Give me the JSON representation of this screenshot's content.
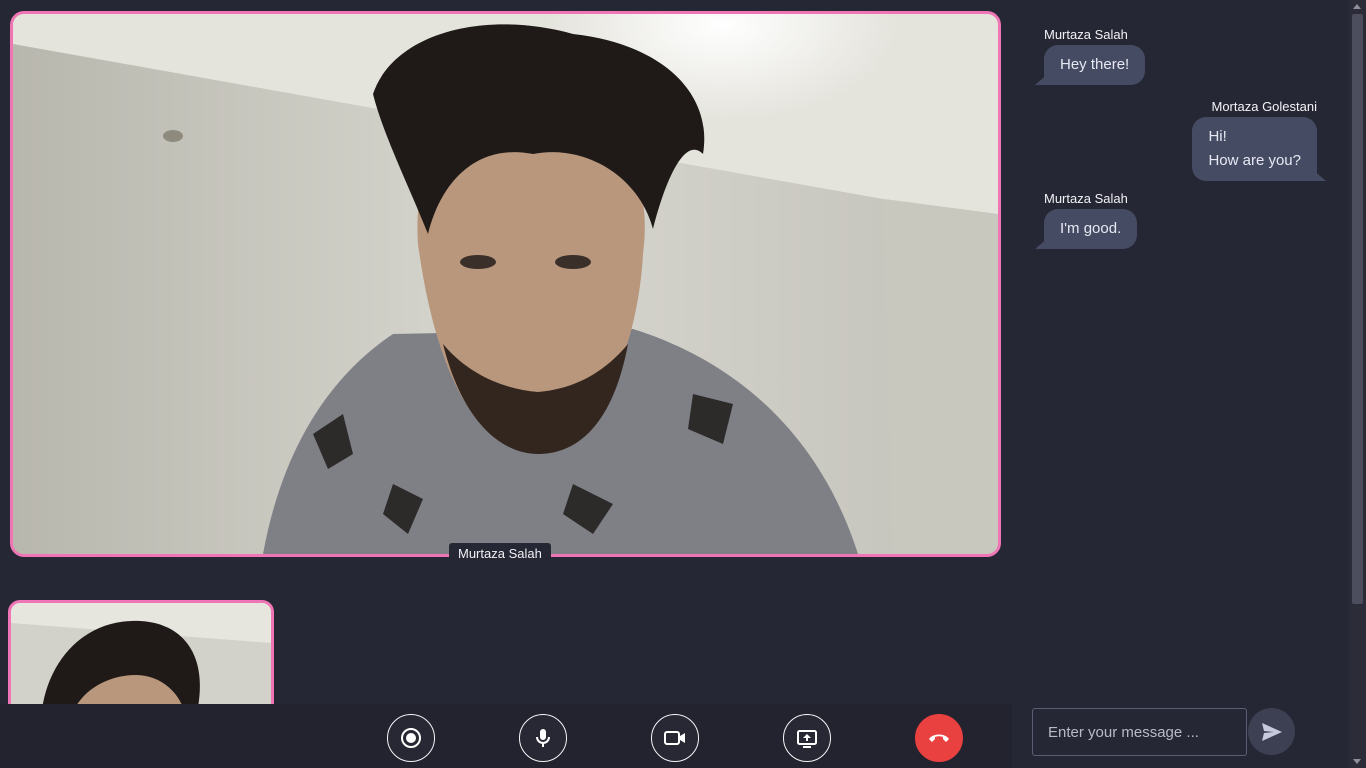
{
  "main_video": {
    "participant_name": "Murtaza Salah"
  },
  "controls": [
    {
      "name": "record-button",
      "icon": "record-icon"
    },
    {
      "name": "microphone-button",
      "icon": "microphone-icon"
    },
    {
      "name": "camera-button",
      "icon": "video-camera-icon"
    },
    {
      "name": "share-screen-button",
      "icon": "share-screen-icon"
    },
    {
      "name": "hang-up-button",
      "icon": "phone-hangup-icon"
    }
  ],
  "chat": {
    "messages": [
      {
        "sender": "Murtaza Salah",
        "text": "Hey there!",
        "side": "left"
      },
      {
        "sender": "Mortaza Golestani",
        "text": "Hi!\nHow are you?",
        "side": "right"
      },
      {
        "sender": "Murtaza Salah",
        "text": "I'm good.",
        "side": "left"
      }
    ],
    "input_placeholder": "Enter your message ...",
    "input_value": ""
  },
  "colors": {
    "background": "#262734",
    "video_border": "#f075b5",
    "hangup": "#e94040",
    "bubble": "#454b63"
  }
}
